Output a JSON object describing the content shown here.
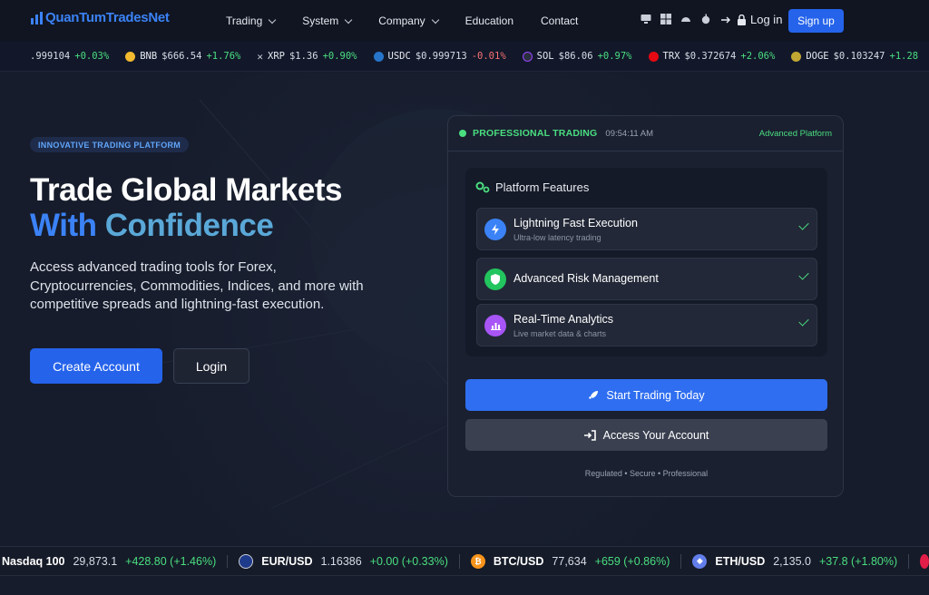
{
  "brand": {
    "name": "QuanTumTradesNet"
  },
  "nav": {
    "links": [
      {
        "label": "Trading",
        "dropdown": true
      },
      {
        "label": "System",
        "dropdown": true
      },
      {
        "label": "Company",
        "dropdown": true
      },
      {
        "label": "Education",
        "dropdown": false
      },
      {
        "label": "Contact",
        "dropdown": false
      }
    ],
    "login_label": "Log in",
    "signup_label": "Sign up"
  },
  "ticker_top": [
    {
      "symbol": "",
      "price": ".999104",
      "change": "+0.03%",
      "direction": "up",
      "icon": "none"
    },
    {
      "symbol": "BNB",
      "price": "$666.54",
      "change": "+1.76%",
      "direction": "up",
      "icon": "bnb-icon"
    },
    {
      "symbol": "XRP",
      "price": "$1.36",
      "change": "+0.90%",
      "direction": "up",
      "icon": "xrp-icon"
    },
    {
      "symbol": "USDC",
      "price": "$0.999713",
      "change": "-0.01%",
      "direction": "down",
      "icon": "usdc-icon"
    },
    {
      "symbol": "SOL",
      "price": "$86.06",
      "change": "+0.97%",
      "direction": "up",
      "icon": "sol-icon"
    },
    {
      "symbol": "TRX",
      "price": "$0.372674",
      "change": "+2.06%",
      "direction": "up",
      "icon": "trx-icon"
    },
    {
      "symbol": "DOGE",
      "price": "$0.103247",
      "change": "+1.28",
      "direction": "up",
      "icon": "doge-icon"
    }
  ],
  "hero": {
    "tagline": "INNOVATIVE TRADING PLATFORM",
    "title_line1": "Trade Global Markets",
    "title_line2a": "With ",
    "title_line2b": "Confidence",
    "description": "Access advanced trading tools for Forex, Cryptocurrencies, Commodities, Indices, and more with competitive spreads and lightning-fast execution.",
    "create_label": "Create Account",
    "login_label": "Login"
  },
  "panel": {
    "status": "PROFESSIONAL TRADING",
    "time": "09:54:11 AM",
    "badge": "Advanced Platform",
    "features_title": "Platform Features",
    "features": [
      {
        "title": "Lightning Fast Execution",
        "subtitle": "Ultra-low latency trading",
        "color": "#3b82f6"
      },
      {
        "title": "Advanced Risk Management",
        "subtitle": "",
        "color": "#22c55e"
      },
      {
        "title": "Real-Time Analytics",
        "subtitle": "Live market data & charts",
        "color": "#a855f7"
      }
    ],
    "start_label": "Start Trading Today",
    "access_label": "Access Your Account",
    "footer": "Regulated • Secure • Professional"
  },
  "ticker_bottom": [
    {
      "name": "Nasdaq 100",
      "price": "29,873.1",
      "change": "+428.80 (+1.46%)",
      "icon": "none"
    },
    {
      "name": "EUR/USD",
      "price": "1.16386",
      "change": "+0.00 (+0.33%)",
      "icon": "eu-us-flag-icon"
    },
    {
      "name": "BTC/USD",
      "price": "77,634",
      "change": "+659 (+0.86%)",
      "icon": "btc-icon"
    },
    {
      "name": "ETH/USD",
      "price": "2,135.0",
      "change": "+37.8 (+1.80%)",
      "icon": "eth-icon"
    }
  ],
  "colors": {
    "accent": "#2563eb",
    "positive": "#4ade80",
    "negative": "#f87171",
    "background": "#161c2b"
  }
}
